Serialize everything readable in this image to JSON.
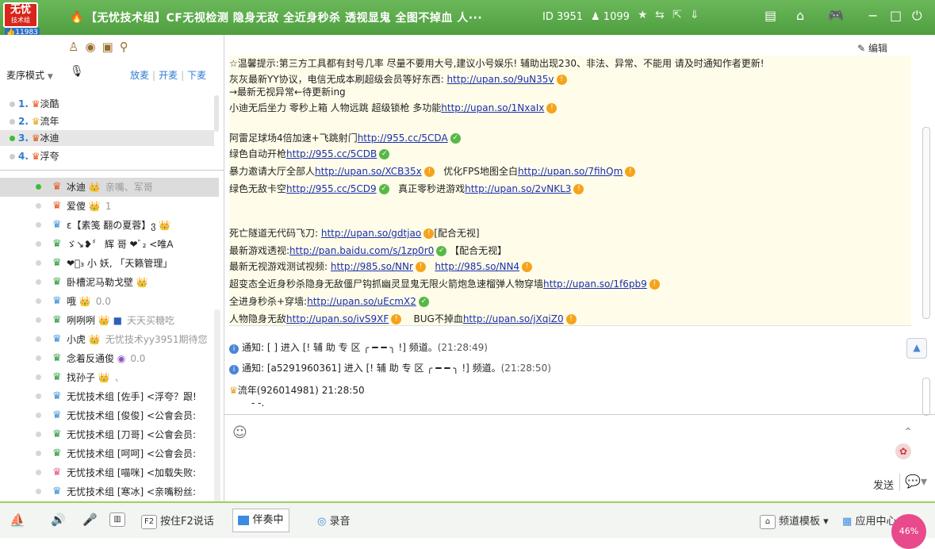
{
  "titlebar": {
    "logo_main": "无忧",
    "logo_sub": "技术组",
    "logo_count": "11983",
    "title": "【无忧技术组】CF无视检测 隐身无敌 全近身秒杀 透视显鬼 全图不掉血 人···",
    "channel_id": "ID 3951",
    "online_count": "1099",
    "icons": [
      "star-icon",
      "share-icon",
      "export-icon",
      "download-icon",
      "menu-icon",
      "home-icon",
      "game-icon",
      "minimize-icon",
      "maximize-icon",
      "power-icon"
    ]
  },
  "left": {
    "tools": [
      "person-icon",
      "location-icon",
      "message-icon",
      "search-icon"
    ],
    "mic_mode": "麦序模式",
    "mic_ops": [
      "放麦",
      "开麦",
      "下麦"
    ],
    "queue": [
      {
        "num": "1.",
        "name": "淡酷"
      },
      {
        "num": "2.",
        "name": "流年"
      },
      {
        "num": "3.",
        "name": "冰迪"
      },
      {
        "num": "4.",
        "name": "浮夸"
      }
    ],
    "members": [
      {
        "name": "冰迪",
        "extra": "亲嘴、军哥",
        "badge_color": "#e8541e"
      },
      {
        "name": "爱傻",
        "extra": "1",
        "badge_color": "#e8541e"
      },
      {
        "name": "ε【素笺 翻の夏蓉】ვ",
        "extra": "",
        "badge_color": "#3a8fd6"
      },
      {
        "name": "ゞ↘❥〞 辉 哥 ❤ﾞ₂ <唯A",
        "extra": "",
        "badge_color": "#2e9a3a"
      },
      {
        "name": "❤ﾞ₃ 小 妖, 「天籁管理」",
        "extra": "",
        "badge_color": "#2e9a3a"
      },
      {
        "name": "卧槽泥马勒戈壁",
        "extra": "",
        "badge_color": "#2e9a3a"
      },
      {
        "name": "哦",
        "extra": "0.0",
        "badge_color": "#3a8fd6"
      },
      {
        "name": "咧咧咧",
        "extra": "天天买糖吃",
        "badge_color": "#2e9a3a"
      },
      {
        "name": "小虎",
        "extra": "无忧技术yy3951期待您",
        "badge_color": "#3a8fd6"
      },
      {
        "name": "念着反通俊",
        "extra": "0.0",
        "badge_color": "#2e9a3a"
      },
      {
        "name": "找孙子",
        "extra": "、",
        "badge_color": "#2e9a3a"
      },
      {
        "name": "无忧技术组 [佐手] <浮夸？跟!",
        "extra": "",
        "badge_color": "#3a8fd6"
      },
      {
        "name": "无忧技术组 [俊俊] <公會会员:",
        "extra": "",
        "badge_color": "#3a8fd6"
      },
      {
        "name": "无忧技术组 [刀哥] <公會会员:",
        "extra": "",
        "badge_color": "#2e9a3a"
      },
      {
        "name": "无忧技术组 [呵呵] <公會会员:",
        "extra": "",
        "badge_color": "#2e9a3a"
      },
      {
        "name": "无忧技术组 [喵咪] <加载失败:",
        "extra": "",
        "badge_color": "#e85a8a"
      },
      {
        "name": "无忧技术组 [寒冰] <亲嘴粉丝:",
        "extra": "",
        "badge_color": "#3a8fd6"
      }
    ]
  },
  "chat": {
    "edit_label": "编辑",
    "notice": [
      {
        "text": "☆温馨提示:第三方工具都有封号几率 尽量不要用大号,建议小号娱乐! 辅助出现230、非法、异常、不能用 请及时通知作者更新!",
        "link": "",
        "after": ""
      },
      {
        "text": "灰灰最新YY协议，电信无成本刷超级会员等好东西:",
        "link": "http://upan.so/9uN35v",
        "after": ""
      },
      {
        "text": "→最新无视异常←待更新ing",
        "link": "",
        "after": ""
      },
      {
        "text": "小迪无后坐力 零秒上箱 人物远跳 超级锁枪 多功能",
        "link": "http://upan.so/1NxaIx",
        "after": ""
      },
      {
        "text": "",
        "link": "",
        "after": ""
      },
      {
        "text": "阿雷足球场4倍加速+飞跳射门",
        "link": "http://955.cc/5CDA",
        "after": ""
      },
      {
        "text": "绿色自动开枪",
        "link": "http://955.cc/5CDB",
        "after": ""
      },
      {
        "text": "暴力邀请大厅全部人",
        "link": "http://upan.so/XCB35x",
        "after": "优化FPS地图全白"
      },
      {
        "text": "绿色无敌卡空",
        "link": "http://955.cc/5CD9",
        "after": "真正零秒进游戏"
      },
      {
        "text": "",
        "link": "",
        "after": ""
      },
      {
        "text": "",
        "link": "",
        "after": ""
      },
      {
        "text": "死亡隧道无代码飞刀:",
        "link": "http://upan.so/gdtjao",
        "after": "[配合无视]"
      },
      {
        "text": "最新游戏透视:",
        "link": "http://pan.baidu.com/s/1zp0r0",
        "after": "【配合无视】"
      },
      {
        "text": "最新无视游戏测试视频:",
        "link": "http://985.so/NNr",
        "after": ""
      },
      {
        "text": "超变态全近身秒杀隐身无敌僵尸钩抓幽灵显鬼无限火箭炮急速榴弹人物穿墙",
        "link": "http://upan.so/1f6pb9",
        "after": ""
      },
      {
        "text": "全进身秒杀+穿墙:",
        "link": "http://upan.so/uEcmX2",
        "after": ""
      },
      {
        "text": "人物隐身无敌",
        "link": "http://upan.so/ivS9XF",
        "after": "BUG不掉血"
      }
    ],
    "extra_links": {
      "l7": "http://upan.so/7fihQm",
      "l8": "http://upan.so/2vNKL3",
      "l13": "http://985.so/NN4",
      "l16": "http://upan.so/jXqiZ0"
    },
    "messages": [
      {
        "prefix": "通知:",
        "who": "[ ]",
        "action": "进入 [! 辅 助 专 区   ╭ ━ ━ ╮ !] 频道。",
        "time": "(21:28:49)"
      },
      {
        "prefix": "通知:",
        "who": "[a5291960361]",
        "action": "进入 [! 辅 助 专 区   ╭ ━ ━ ╮ !] 频道。",
        "time": "(21:28:50)"
      }
    ],
    "last_sender": "流年",
    "last_sender_id": "(926014981)",
    "last_time": "21:28:50",
    "last_text": "- -.",
    "send_label": "发送"
  },
  "bottom": {
    "f2_label": "按住F2说话",
    "accompany_label": "伴奏中",
    "record_label": "录音",
    "template_label": "频道模板",
    "apps_label": "应用中心",
    "progress_pct": "46%"
  }
}
